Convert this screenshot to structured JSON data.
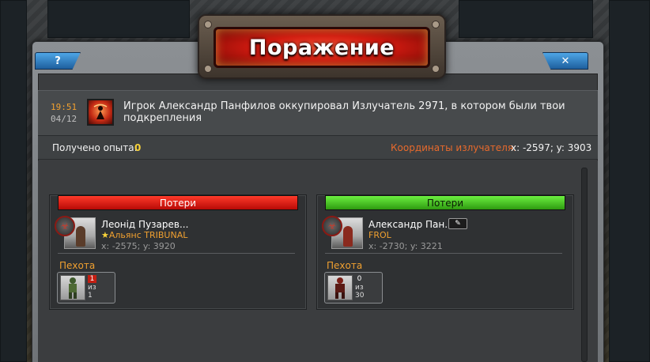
{
  "window": {
    "title": "Поражение",
    "help_label": "?",
    "close_label": "✕"
  },
  "event": {
    "time": "19:51",
    "date": "04/12",
    "icon": "biohazard-emitter-icon",
    "message": "Игрок Александр Панфилов оккупировал Излучатель 2971, в котором были твои подкрепления"
  },
  "stats": {
    "xp_label": "Получено опыта:",
    "xp_value": "0",
    "coords_label": "Координаты излучателя:",
    "coords_value": "x: -2597; y: 3903"
  },
  "panels": {
    "left": {
      "header": "Потери",
      "header_color": "#d8140c",
      "player_name": "Леонід Пузарев...",
      "alliance": "Альянс TRIBUNAL",
      "coords": "x: -2575; y: 3920",
      "section": "Пехота",
      "unit": {
        "lost": "1",
        "of_label": "из",
        "total": "1"
      }
    },
    "right": {
      "header": "Потери",
      "header_color": "#4cc024",
      "player_name": "Александр Пан...",
      "alliance": "FROL",
      "coords": "x: -2730; y: 3221",
      "section": "Пехота",
      "unit": {
        "lost": "0",
        "of_label": "из",
        "total": "30"
      }
    }
  }
}
